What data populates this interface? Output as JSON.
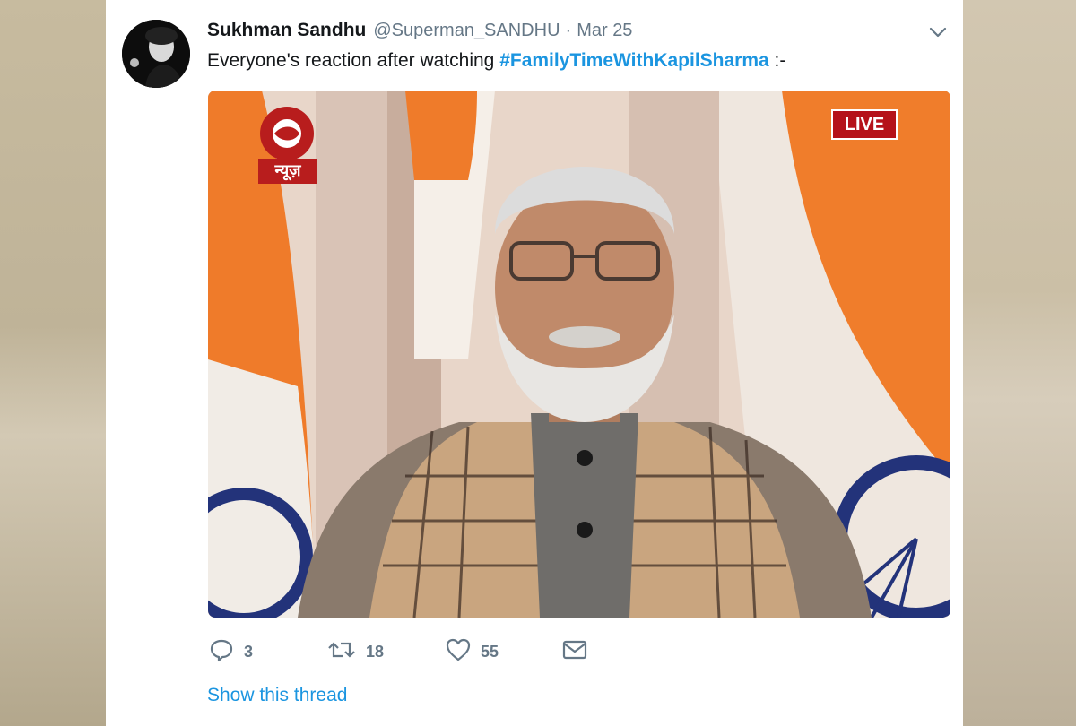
{
  "tweet": {
    "author_name": "Sukhman Sandhu",
    "author_handle": "@Superman_SANDHU",
    "separator": "·",
    "date": "Mar 25",
    "text_before": "Everyone's reaction after watching ",
    "hashtag": "#FamilyTimeWithKapilSharma",
    "text_after": " :-",
    "more_icon": "chevron-down-icon"
  },
  "media": {
    "channel_logo_text": "न्यूज़",
    "live_badge": "LIVE"
  },
  "actions": {
    "reply_count": "3",
    "retweet_count": "18",
    "like_count": "55"
  },
  "thread_link": "Show this thread",
  "colors": {
    "link": "#1b95e0",
    "text": "#14171a",
    "muted": "#657786",
    "live_red": "#c0131b"
  }
}
